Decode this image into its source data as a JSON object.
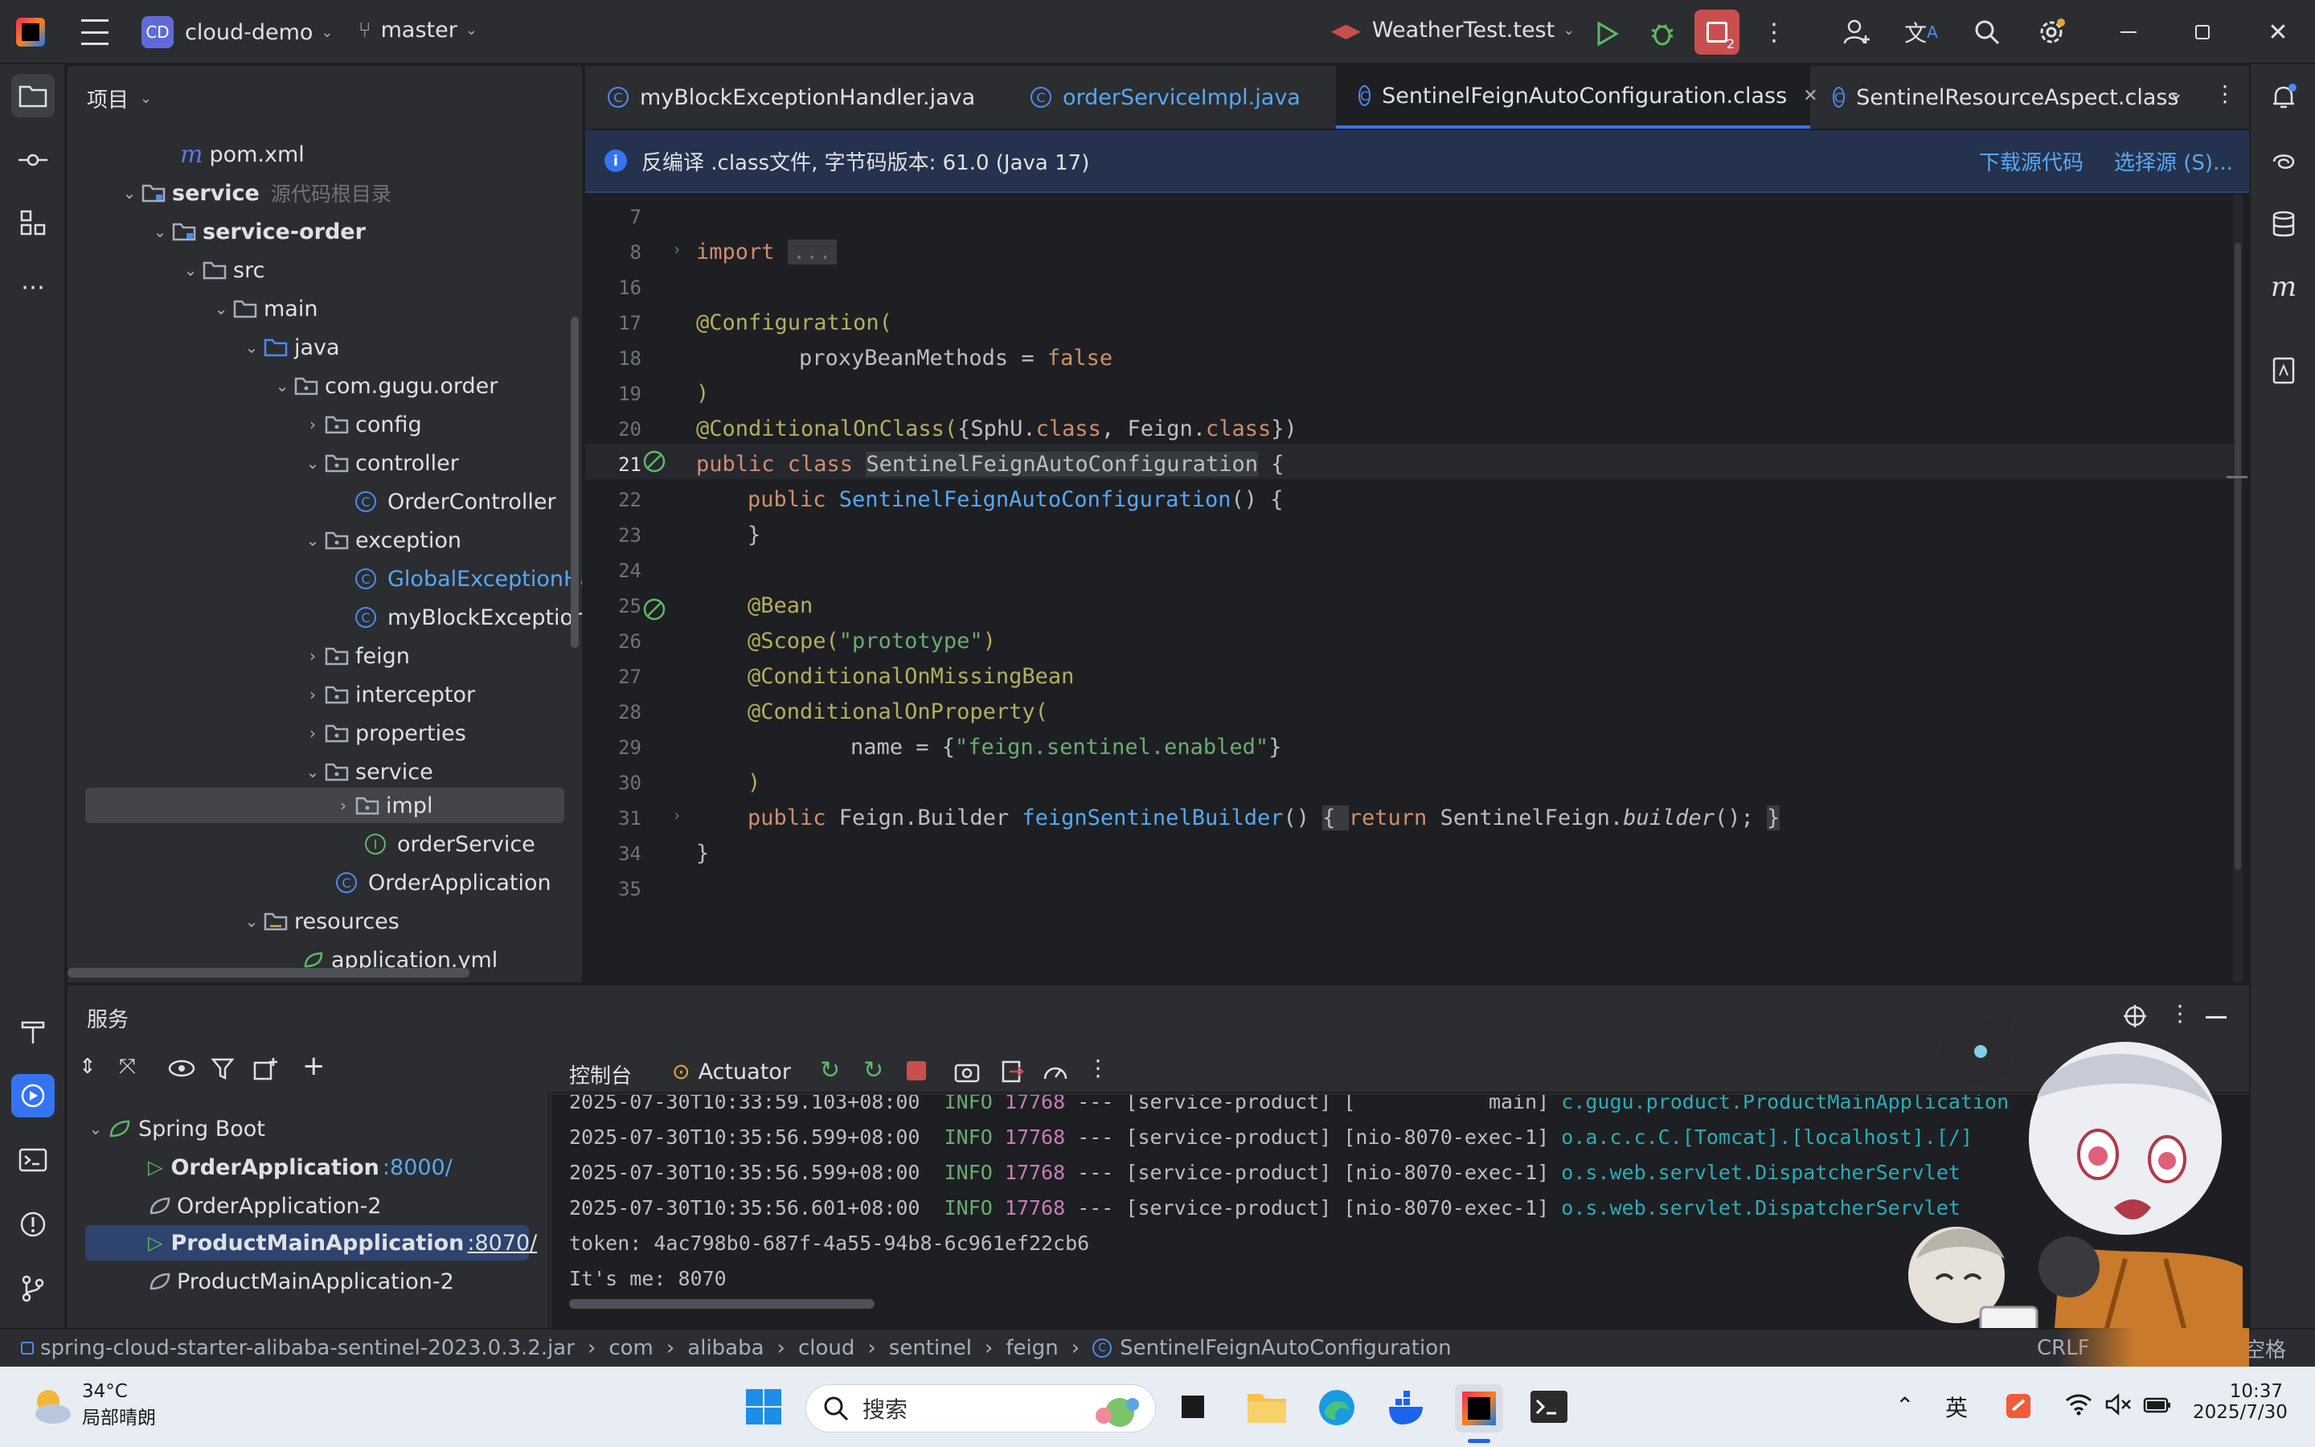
{
  "titlebar": {
    "project_badge": "CD",
    "project_name": "cloud-demo",
    "branch": "master",
    "run_config": "WeatherTest.test",
    "notif_count": "2"
  },
  "project_panel": {
    "title": "项目",
    "items": [
      {
        "label": "pom.xml",
        "hint": "",
        "icon": "maven-icon"
      },
      {
        "label": "service",
        "hint": "源代码根目录",
        "icon": "module-folder-icon"
      },
      {
        "label": "service-order",
        "hint": "",
        "icon": "module-folder-icon"
      },
      {
        "label": "src",
        "hint": "",
        "icon": "folder-icon"
      },
      {
        "label": "main",
        "hint": "",
        "icon": "folder-icon"
      },
      {
        "label": "java",
        "hint": "",
        "icon": "source-folder-icon"
      },
      {
        "label": "com.gugu.order",
        "hint": "",
        "icon": "package-icon"
      },
      {
        "label": "config",
        "hint": "",
        "icon": "package-icon"
      },
      {
        "label": "controller",
        "hint": "",
        "icon": "package-icon"
      },
      {
        "label": "OrderController",
        "hint": "",
        "icon": "class-icon"
      },
      {
        "label": "exception",
        "hint": "",
        "icon": "package-icon"
      },
      {
        "label": "GlobalExceptionHa",
        "hint": "",
        "icon": "class-icon"
      },
      {
        "label": "myBlockExceptionH",
        "hint": "",
        "icon": "class-icon"
      },
      {
        "label": "feign",
        "hint": "",
        "icon": "package-icon"
      },
      {
        "label": "interceptor",
        "hint": "",
        "icon": "package-icon"
      },
      {
        "label": "properties",
        "hint": "",
        "icon": "package-icon"
      },
      {
        "label": "service",
        "hint": "",
        "icon": "package-icon"
      },
      {
        "label": "impl",
        "hint": "",
        "icon": "package-icon"
      },
      {
        "label": "orderService",
        "hint": "",
        "icon": "interface-icon"
      },
      {
        "label": "OrderApplication",
        "hint": "",
        "icon": "spring-class-icon"
      },
      {
        "label": "resources",
        "hint": "",
        "icon": "resources-folder-icon"
      },
      {
        "label": "application.yml",
        "hint": "",
        "icon": "yaml-icon"
      }
    ]
  },
  "editor": {
    "tabs": [
      {
        "label": "myBlockExceptionHandler.java"
      },
      {
        "label": "orderServiceImpl.java"
      },
      {
        "label": "SentinelFeignAutoConfiguration.class"
      },
      {
        "label": "SentinelResourceAspect.class"
      }
    ],
    "banner_text": "反编译 .class文件, 字节码版本: 61.0 (Java 17)",
    "banner_download": "下载源代码",
    "banner_choose": "选择源 (S)...",
    "line_numbers": [
      "7",
      "8",
      "16",
      "17",
      "18",
      "19",
      "20",
      "21",
      "22",
      "23",
      "24",
      "25",
      "26",
      "27",
      "28",
      "29",
      "30",
      "31",
      "34",
      "35"
    ],
    "code": {
      "l8_import": "import",
      "l8_fold": "...",
      "l17": "@Configuration(",
      "l18_a": "proxyBeanMethods = ",
      "l18_b": "false",
      "l19": ")",
      "l20_a": "@ConditionalOnClass(",
      "l20_b": "{SphU.",
      "l20_c": "class",
      "l20_d": ", Feign.",
      "l20_e": "class",
      "l20_f": "})",
      "l21_a": "public class ",
      "l21_b": "SentinelFeignAutoConfiguration",
      "l21_c": " {",
      "l22_a": "public ",
      "l22_b": "SentinelFeignAutoConfiguration",
      "l22_c": "() {",
      "l23": "}",
      "l25": "@Bean",
      "l26_a": "@Scope(",
      "l26_b": "\"prototype\"",
      "l26_c": ")",
      "l27": "@ConditionalOnMissingBean",
      "l28": "@ConditionalOnProperty(",
      "l29_a": "name = {",
      "l29_b": "\"feign.sentinel.enabled\"",
      "l29_c": "}",
      "l30": ")",
      "l31_a": "public ",
      "l31_b": "Feign.Builder ",
      "l31_c": "feignSentinelBuilder",
      "l31_d": "() ",
      "l31_e": "{ ",
      "l31_f": "return ",
      "l31_g": "SentinelFeign.",
      "l31_h": "builder",
      "l31_i": "(); ",
      "l31_j": "}",
      "l34": "}"
    }
  },
  "services": {
    "title": "服务",
    "tree_root": "Spring Boot",
    "apps": [
      {
        "name": "OrderApplication",
        "port": ":8000/"
      },
      {
        "name": "OrderApplication-2",
        "port": ""
      },
      {
        "name": "ProductMainApplication",
        "port": ":8070/"
      },
      {
        "name": "ProductMainApplication-2",
        "port": ""
      }
    ],
    "console_tab": "控制台",
    "actuator_tab": "Actuator",
    "logs": [
      {
        "time": "2025-07-30T10:33:59.103+08:00",
        "level": "INFO",
        "pid": "17768",
        "sep": " --- [service-product] [           main] ",
        "cls": "c.gugu.product.ProductMainApplication"
      },
      {
        "time": "2025-07-30T10:35:56.599+08:00",
        "level": "INFO",
        "pid": "17768",
        "sep": " --- [service-product] [nio-8070-exec-1] ",
        "cls": "o.a.c.c.C.[Tomcat].[localhost].[/]"
      },
      {
        "time": "2025-07-30T10:35:56.599+08:00",
        "level": "INFO",
        "pid": "17768",
        "sep": " --- [service-product] [nio-8070-exec-1] ",
        "cls": "o.s.web.servlet.DispatcherServlet"
      },
      {
        "time": "2025-07-30T10:35:56.601+08:00",
        "level": "INFO",
        "pid": "17768",
        "sep": " --- [service-product] [nio-8070-exec-1] ",
        "cls": "o.s.web.servlet.DispatcherServlet"
      }
    ],
    "plain_logs": [
      "token: 4ac798b0-687f-4a55-94b8-6c961ef22cb6",
      "It's me: 8070"
    ]
  },
  "statusbar": {
    "crumbs": [
      "spring-cloud-starter-alibaba-sentinel-2023.0.3.2.jar",
      "com",
      "alibaba",
      "cloud",
      "sentinel",
      "feign",
      "SentinelFeignAutoConfiguration"
    ],
    "line_sep": "CRLF",
    "indent": "空格"
  },
  "taskbar": {
    "temp": "34°C",
    "weather": "局部晴朗",
    "search": "搜索",
    "ime": "英",
    "time": "10:37",
    "date": "2025/7/30"
  },
  "colors": {
    "accent": "#3574f0",
    "keyword": "#cf8e6d",
    "annotation": "#b3ae60",
    "string": "#6aab73",
    "function": "#56a8f5"
  }
}
